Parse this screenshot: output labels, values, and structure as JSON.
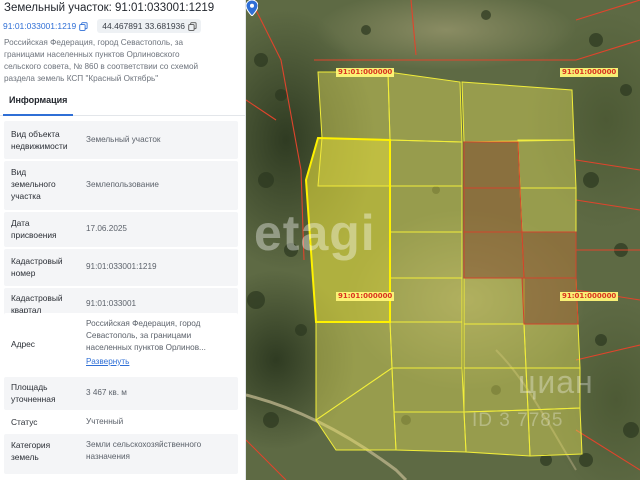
{
  "panel": {
    "title": "Земельный участок: 91:01:033001:1219",
    "cadastral_chip": "91:01:033001:1219",
    "coords_chip": "44.467891 33.681936",
    "address_lines": [
      "Российская Федерация, город Севастополь, за",
      "границами населенных пунктов Орлиновского",
      "сельского совета, № 860 в соответствии со схемой",
      "раздела земель КСП \"Красный Октябрь\""
    ],
    "tab": "Информация",
    "rows": [
      {
        "label": [
          "Вид объекта",
          "недвижимости"
        ],
        "value": [
          "Земельный участок"
        ]
      },
      {
        "label": [
          "Вид",
          "земельного",
          "участка"
        ],
        "value": [
          "Землепользование"
        ]
      },
      {
        "label": [
          "Дата",
          "присвоения"
        ],
        "value": [
          "17.06.2025"
        ]
      },
      {
        "label": [
          "Кадастровый",
          "номер"
        ],
        "value": [
          "91:01:033001:1219"
        ]
      },
      {
        "label": [
          "Кадастровый",
          "квартал"
        ],
        "value": [
          "91:01:033001"
        ]
      },
      {
        "label": [
          "Адрес"
        ],
        "value": [
          "Российская Федерация, город",
          "Севастополь, за границами",
          "населенных пунктов Орлинов..."
        ],
        "link": "Развернуть"
      },
      {
        "label": [
          "Площадь",
          "уточненная"
        ],
        "value": [
          "3 467 кв. м"
        ]
      },
      {
        "label": [
          "Статус"
        ],
        "value": [
          "Учтенный"
        ]
      },
      {
        "label": [
          "Категория",
          "земель"
        ],
        "value": [
          "Земли сельскохозяйственного",
          "назначения"
        ]
      }
    ]
  },
  "map": {
    "quarter_labels": [
      "91:01:000000",
      "91:01:000000",
      "91:01:000000",
      "91:01:000000"
    ],
    "watermark_main": "etagi",
    "watermark_brand": "циан",
    "watermark_id": "ID 3 7785",
    "colors": {
      "parcel_fill": "#e8e25a",
      "parcel_stroke": "#f2ee3a",
      "selected_stroke": "#fff200",
      "boundary_red": "#e0442c",
      "link_blue": "#2f6fd6"
    },
    "marker_icon": "location-pin-icon"
  }
}
